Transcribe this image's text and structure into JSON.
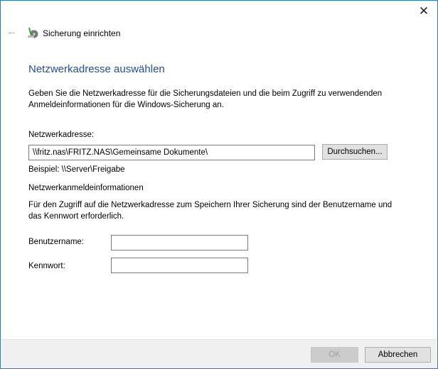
{
  "window": {
    "title": "Sicherung einrichten",
    "close_icon": "close-icon",
    "back_icon": "back-arrow-icon"
  },
  "heading": "Netzwerkadresse auswählen",
  "description": [
    "Geben Sie die Netzwerkadresse für die Sicherungsdateien und die beim Zugriff zu verwendenden",
    "Anmeldeinformationen für die Windows-Sicherung an."
  ],
  "address": {
    "label": "Netzwerkadresse:",
    "value": "\\\\fritz.nas\\FRITZ.NAS\\Gemeinsame Dokumente\\",
    "browse": "Durchsuchen...",
    "example": "Beispiel: \\\\Server\\Freigabe"
  },
  "credentials": {
    "heading": "Netzwerkanmeldeinformationen",
    "text": [
      "Für den Zugriff auf die Netzwerkadresse zum Speichern Ihrer Sicherung sind der Benutzername und",
      "das Kennwort erforderlich."
    ],
    "username_label": "Benutzername:",
    "username_value": "",
    "password_label": "Kennwort:",
    "password_value": ""
  },
  "footer": {
    "ok": "OK",
    "cancel": "Abbrechen"
  }
}
